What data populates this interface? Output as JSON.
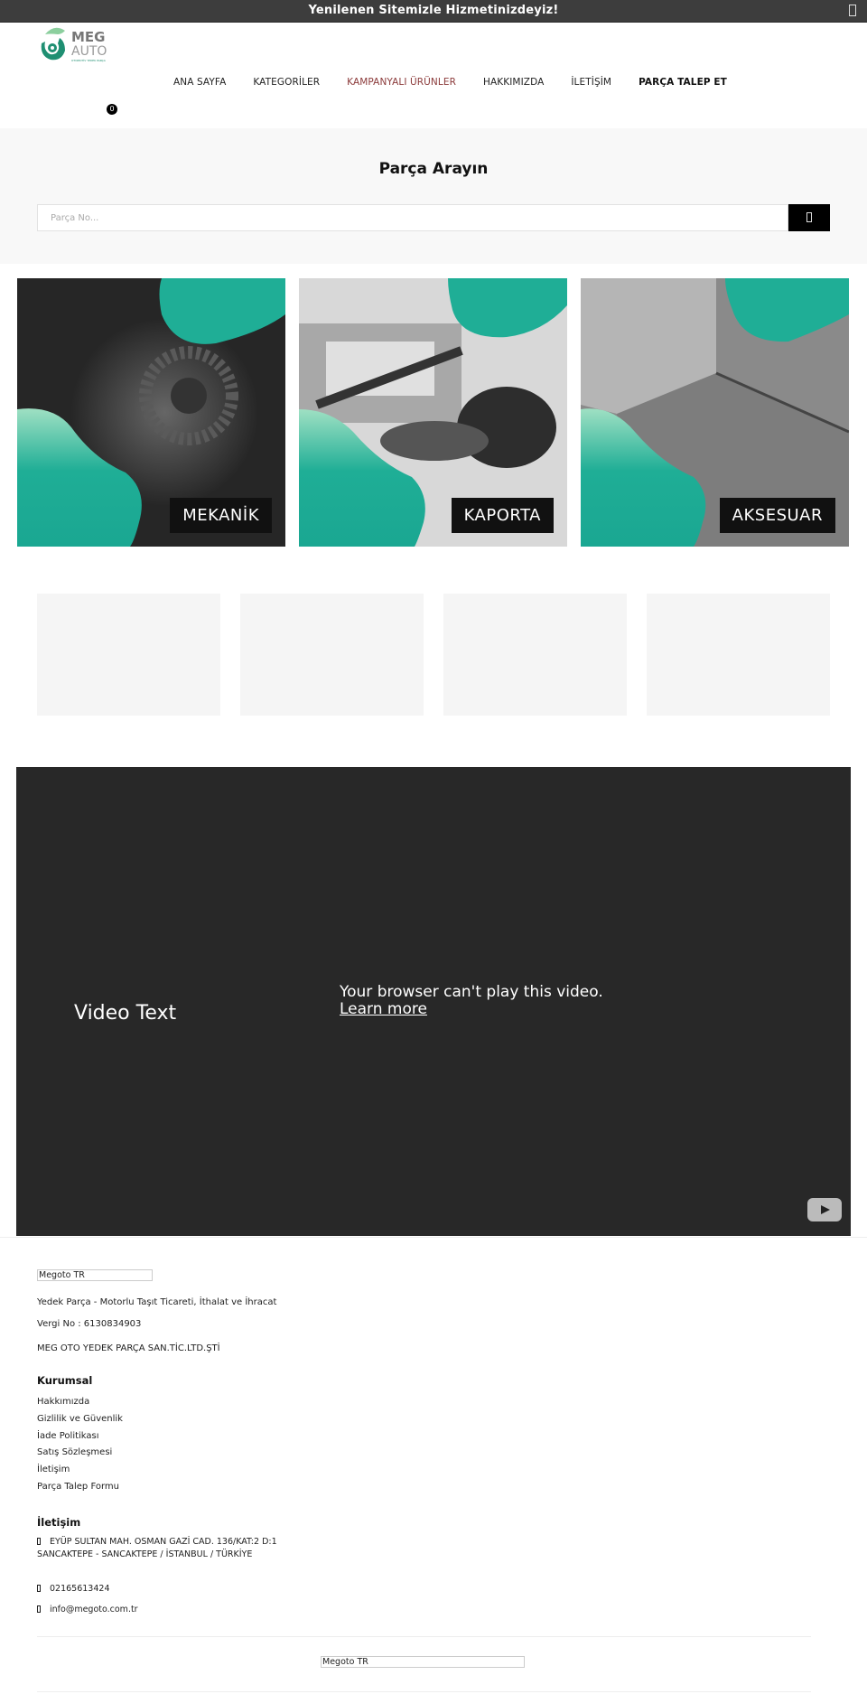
{
  "announcement": {
    "text": "Yenilenen Sitemizle Hizmetinizdeyiz!",
    "close_icon": "close-icon"
  },
  "logo": {
    "line1": "MEG",
    "line2": "AUTO",
    "tagline": "OTOMOTİV YEDEK PARÇA"
  },
  "nav": {
    "items": [
      {
        "label": "ANA SAYFA"
      },
      {
        "label": "KATEGORİLER"
      },
      {
        "label": "KAMPANYALI ÜRÜNLER"
      },
      {
        "label": "HAKKIMIZDA"
      },
      {
        "label": "İLETİŞİM"
      },
      {
        "label": "PARÇA TALEP ET"
      }
    ],
    "cart_count": "0"
  },
  "search": {
    "title": "Parça Arayın",
    "placeholder": "Parça No...",
    "value": "",
    "button_icon": "search-icon"
  },
  "categories": [
    {
      "label": "MEKANİK"
    },
    {
      "label": "KAPORTA"
    },
    {
      "label": "AKSESUAR"
    }
  ],
  "colors": {
    "accent": "#1fae96",
    "topbar": "#3d3d3d",
    "campaign": "#8b3a3a"
  },
  "video": {
    "title": "Video Text",
    "message": "Your browser can't play this video.",
    "link": "Learn more"
  },
  "footer": {
    "brand": "Megoto TR",
    "description": "Yedek Parça - Motorlu Taşıt Ticareti, İthalat ve İhracat",
    "tax_no": "Vergi No : 6130834903",
    "company": "MEG OTO YEDEK PARÇA SAN.TİC.LTD.ŞTİ",
    "corporate": {
      "heading": "Kurumsal",
      "links": [
        {
          "label": "Hakkımızda"
        },
        {
          "label": "Gizlilik ve Güvenlik"
        },
        {
          "label": "İade Politikası"
        },
        {
          "label": "Satış Sözleşmesi"
        },
        {
          "label": "İletişim"
        },
        {
          "label": "Parça Talep Formu"
        }
      ]
    },
    "contact": {
      "heading": "İletişim",
      "address": "EYÜP SULTAN MAH. OSMAN GAZİ CAD. 136/KAT:2 D:1 SANCAKTEPE - SANCAKTEPE / İSTANBUL / TÜRKİYE",
      "phone": "02165613424",
      "email": "info@megoto.com.tr"
    },
    "bottom_brand": "Megoto TR"
  }
}
